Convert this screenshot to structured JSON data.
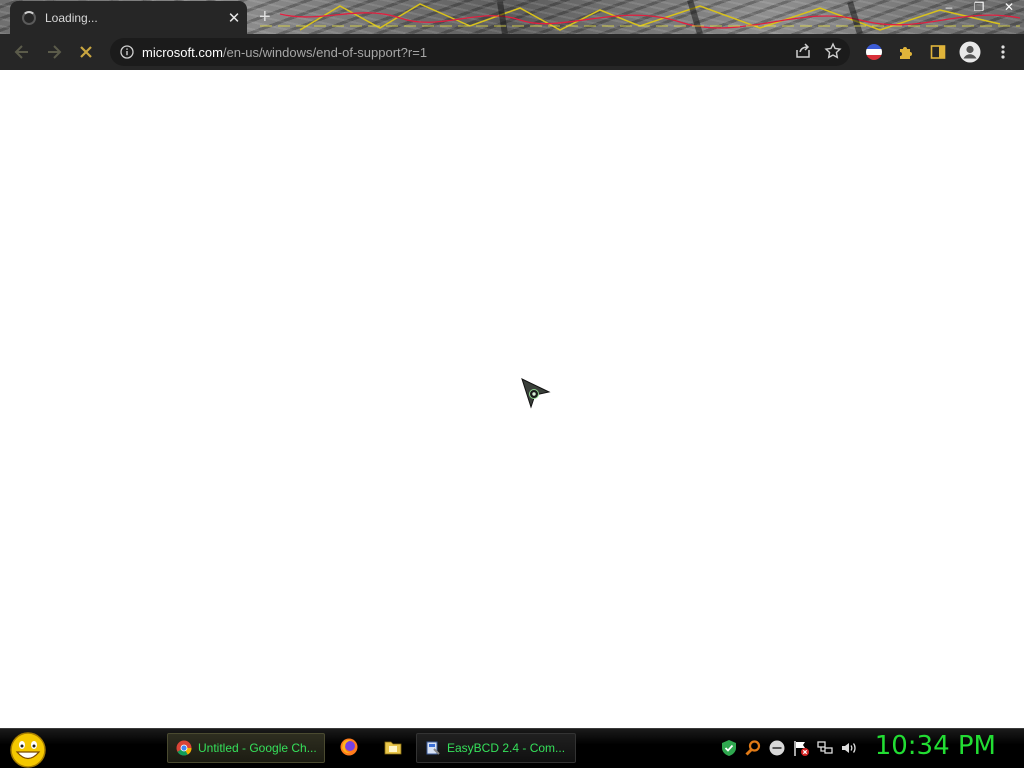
{
  "browser": {
    "tab": {
      "title": "Loading...",
      "close_glyph": "✕"
    },
    "new_tab_glyph": "+",
    "window_controls": {
      "minimize": "–",
      "maximize": "❐",
      "close": "✕"
    },
    "url_host": "microsoft.com",
    "url_path": "/en-us/windows/end-of-support?r=1",
    "icons": [
      "back-icon",
      "forward-icon",
      "stop-icon",
      "site-info-icon",
      "share-icon",
      "bookmark-star-icon",
      "extension-flag-icon",
      "extensions-puzzle-icon",
      "side-panel-icon",
      "profile-icon",
      "menu-icon"
    ]
  },
  "taskbar": {
    "tasks": [
      {
        "label": "Untitled - Google Ch...",
        "icon": "chrome-icon",
        "active": true
      },
      {
        "label": "EasyBCD 2.4 - Com...",
        "icon": "easybcd-icon",
        "active": false
      }
    ],
    "quick_launch": [
      "firefox-icon",
      "folder-icon"
    ],
    "tray": [
      "shield-check-icon",
      "search-tool-icon",
      "minus-circle-icon",
      "flag-alert-icon",
      "network-icon",
      "volume-icon"
    ],
    "clock": "10:34 PM"
  },
  "colors": {
    "toolbar_bg": "#262626",
    "taskbar_text": "#35e05a",
    "clock": "#22dd33"
  }
}
